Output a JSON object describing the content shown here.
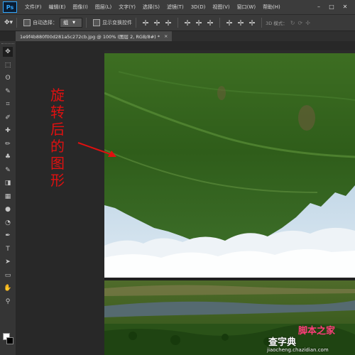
{
  "app": {
    "logo": "Ps"
  },
  "menu": {
    "items": [
      "文件(F)",
      "编辑(E)",
      "图像(I)",
      "图层(L)",
      "文字(Y)",
      "选择(S)",
      "滤镜(T)",
      "3D(D)",
      "视图(V)",
      "窗口(W)",
      "帮助(H)"
    ]
  },
  "window_controls": {
    "minimize": "–",
    "maximize": "□",
    "close": "✕"
  },
  "options_bar": {
    "auto_select_label": "自动选择：",
    "auto_select_value": "组",
    "show_transform_label": "显示变换控件",
    "mode_label": "3D 模式："
  },
  "document_tab": {
    "title": "1e9f4b880f00d281a5c272cb.jpg @ 100% (图层 2, RGB/8#) *",
    "close": "×"
  },
  "tools": {
    "icons": [
      "move-icon",
      "marquee-icon",
      "lasso-icon",
      "quick-select-icon",
      "crop-icon",
      "eyedropper-icon",
      "healing-icon",
      "brush-icon",
      "stamp-icon",
      "history-brush-icon",
      "eraser-icon",
      "gradient-icon",
      "blur-icon",
      "dodge-icon",
      "pen-icon",
      "type-icon",
      "path-select-icon",
      "shape-icon",
      "hand-icon",
      "zoom-icon"
    ],
    "glyphs": [
      "✥",
      "⬚",
      "ʘ",
      "✎",
      "⌗",
      "✐",
      "✚",
      "✏",
      "♣",
      "✎",
      "◨",
      "▦",
      "●",
      "◔",
      "✒",
      "T",
      "➤",
      "▭",
      "✋",
      "⚲"
    ],
    "foreground_color": "#ffffff",
    "background_color": "#000000"
  },
  "annotation": {
    "chars": [
      "旋",
      "转",
      "后",
      "的",
      "图",
      "形"
    ],
    "color": "#e01010"
  },
  "watermark": {
    "main": "查字典",
    "logo": "脚本之家",
    "url": "jiaocheng.chazidian.com"
  }
}
